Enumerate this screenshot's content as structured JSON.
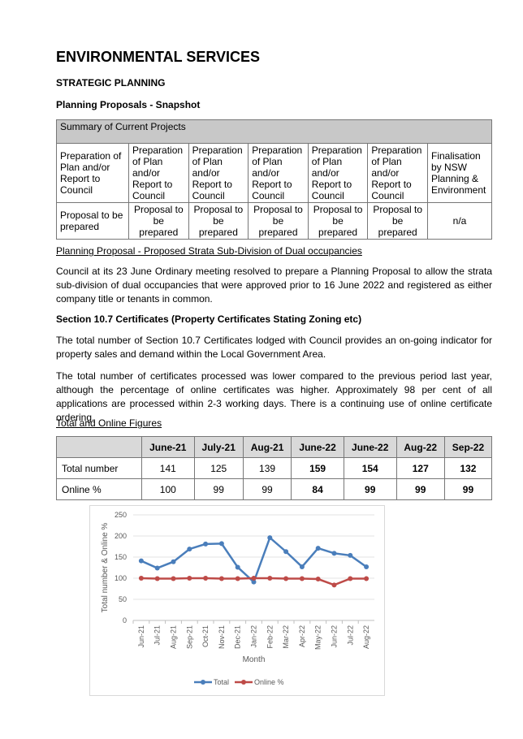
{
  "title": "ENVIRONMENTAL SERVICES",
  "section": "STRATEGIC PLANNING",
  "subsection": "Planning Proposals - Snapshot",
  "projects_table": {
    "caption": "Summary of Current Projects",
    "stages": [
      "Preparation of Plan and/or Report to Council",
      "Preparation of Plan and/or Report to Council",
      "Preparation of Plan and/or Report to Council",
      "Preparation of Plan and/or Report to Council",
      "Preparation of Plan and/or Report to Council",
      "Preparation of Plan and/or Report to Council",
      "Finalisation by NSW Planning & Environment"
    ],
    "status": [
      "Proposal to be prepared",
      "Proposal to be prepared",
      "Proposal to be prepared",
      "Proposal to be prepared",
      "Proposal to be prepared",
      "Proposal to be prepared",
      "n/a"
    ]
  },
  "strata_heading": "Planning Proposal - Proposed Strata Sub-Division of Dual occupancies",
  "strata_text": "Council at its 23 June Ordinary meeting resolved to prepare a Planning Proposal to allow the strata sub-division of dual occupancies that were approved prior to 16 June 2022 and registered as either company title or tenants in common.",
  "cert_heading": "Section 10.7 Certificates (Property Certificates Stating Zoning etc)",
  "cert_text1": "The total number of Section 10.7 Certificates lodged with Council provides an on-going indicator for property sales and demand within the Local Government Area.",
  "cert_text2": "The total number of certificates processed was lower compared to the previous period last year, although the percentage of online certificates was higher. Approximately 98 per cent of all applications are processed within 2-3 working days. There is a continuing use of online certificate ordering.",
  "figures_heading": "Total and Online Figures",
  "figures_table": {
    "columns": [
      "June-21",
      "July-21",
      "Aug-21",
      "June-22",
      "June-22",
      "Aug-22",
      "Sep-22"
    ],
    "rows": [
      {
        "label": "Total number",
        "values": [
          "141",
          "125",
          "139",
          "159",
          "154",
          "127",
          "132"
        ]
      },
      {
        "label": "Online %",
        "values": [
          "100",
          "99",
          "99",
          "84",
          "99",
          "99",
          "99"
        ]
      }
    ]
  },
  "chart_data": {
    "type": "line",
    "xlabel": "Month",
    "ylabel": "Total number & Online %",
    "ylim": [
      0,
      250
    ],
    "yticks": [
      0,
      50,
      100,
      150,
      200,
      250
    ],
    "grid": true,
    "legend": "bottom",
    "categories": [
      "Jun-21",
      "Jul-21",
      "Aug-21",
      "Sep-21",
      "Oct-21",
      "Nov-21",
      "Dec-21",
      "Jan-22",
      "Feb-22",
      "Mar-22",
      "Apr-22",
      "May-22",
      "Jun-22",
      "Jul-22",
      "Aug-22"
    ],
    "series": [
      {
        "name": "Total",
        "color": "#4a7ebb",
        "values": [
          141,
          124,
          139,
          169,
          181,
          182,
          126,
          91,
          196,
          163,
          127,
          171,
          159,
          154,
          127
        ]
      },
      {
        "name": "Online %",
        "color": "#be4b48",
        "values": [
          100,
          99,
          99,
          100,
          100,
          99,
          99,
          100,
          100,
          99,
          99,
          98,
          84,
          99,
          99
        ]
      }
    ]
  }
}
